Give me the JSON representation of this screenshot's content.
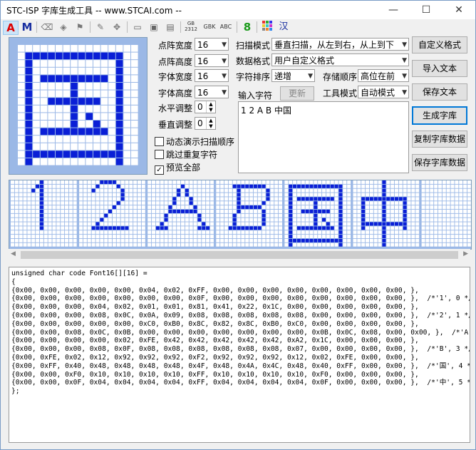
{
  "window": {
    "title": "STC-ISP 字库生成工具 -- www.STCAI.com --",
    "minimize": "—",
    "maximize": "☐",
    "close": "✕"
  },
  "toolbar": {
    "font_a": "A",
    "font_m": "M",
    "gb2312": "GB\n2312",
    "gbk": "GBK",
    "abc": "ABC",
    "eight": "8",
    "han": "汉"
  },
  "settings": {
    "dot_width_label": "点阵宽度",
    "dot_width_value": "16",
    "dot_height_label": "点阵高度",
    "dot_height_value": "16",
    "font_width_label": "字体宽度",
    "font_width_value": "16",
    "font_height_label": "字体高度",
    "font_height_value": "16",
    "h_adjust_label": "水平调整",
    "h_adjust_value": "0",
    "v_adjust_label": "垂直调整",
    "v_adjust_value": "0",
    "scan_mode_label": "扫描模式",
    "scan_mode_value": "垂直扫描，从左到右，从上到下",
    "data_format_label": "数据格式",
    "data_format_value": "用户自定义格式",
    "char_order_label": "字符排序",
    "char_order_value": "递增",
    "storage_order_label": "存储顺序",
    "storage_order_value": "高位在前",
    "input_chars_label": "输入字符",
    "update_button": "更新",
    "tool_mode_label": "工具模式",
    "tool_mode_value": "自动模式",
    "input_chars_value": "1 2 A B 中国"
  },
  "checkboxes": {
    "animate_scan": "动态演示扫描顺序",
    "skip_duplicates": "跳过重复字符",
    "preview_all": "预览全部",
    "preview_all_checked": true
  },
  "buttons": {
    "custom_format": "自定义格式",
    "import_text": "导入文本",
    "save_text": "保存文本",
    "generate_font": "生成字库",
    "copy_font_data": "复制字库数据",
    "save_font_data": "保存字库数据"
  },
  "preview": {
    "chars": [
      "1",
      "2",
      "A",
      "B",
      "中",
      "国"
    ]
  },
  "output": {
    "lines": [
      "unsigned char code Font16[][16] =",
      "{",
      "{0x00, 0x00, 0x00, 0x00, 0x00, 0x04, 0x02, 0xFF, 0x00, 0x00, 0x00, 0x00, 0x00, 0x00, 0x00, 0x00, },",
      "{0x00, 0x00, 0x00, 0x00, 0x00, 0x00, 0x00, 0x0F, 0x00, 0x00, 0x00, 0x00, 0x00, 0x00, 0x00, 0x00, },  /*'1', 0 */",
      "{0x00, 0x00, 0x00, 0x04, 0x02, 0x01, 0x01, 0x81, 0x41, 0x22, 0x1C, 0x00, 0x00, 0x00, 0x00, 0x00, },",
      "{0x00, 0x00, 0x00, 0x08, 0x0C, 0x0A, 0x09, 0x08, 0x08, 0x08, 0x08, 0x08, 0x00, 0x00, 0x00, 0x00, },  /*'2', 1 */",
      "{0x00, 0x00, 0x00, 0x00, 0x00, 0xC0, 0xB0, 0x8C, 0x82, 0x8C, 0xB0, 0xC0, 0x00, 0x00, 0x00, 0x00, },",
      "{0x00, 0x00, 0x08, 0x0C, 0x0B, 0x00, 0x00, 0x00, 0x00, 0x00, 0x00, 0x00, 0x0B, 0x0C, 0x08, 0x00, 0x00, },  /*'A', 2 */",
      "{0x00, 0x00, 0x00, 0x00, 0x02, 0xFE, 0x42, 0x42, 0x42, 0x42, 0x42, 0xA2, 0x1C, 0x00, 0x00, 0x00, },",
      "{0x00, 0x00, 0x00, 0x08, 0x0F, 0x08, 0x08, 0x08, 0x08, 0x08, 0x08, 0x07, 0x00, 0x00, 0x00, 0x00, },  /*'B', 3 */",
      "{0x00, 0xFE, 0x02, 0x12, 0x92, 0x92, 0x92, 0xF2, 0x92, 0x92, 0x92, 0x12, 0x02, 0xFE, 0x00, 0x00, },",
      "{0x00, 0xFF, 0x40, 0x48, 0x48, 0x48, 0x48, 0x4F, 0x48, 0x4A, 0x4C, 0x48, 0x40, 0xFF, 0x00, 0x00, },  /*'国', 4 */",
      "{0x00, 0x00, 0xF0, 0x10, 0x10, 0x10, 0x10, 0xFF, 0x10, 0x10, 0x10, 0x10, 0xF0, 0x00, 0x00, 0x00, },",
      "{0x00, 0x00, 0x0F, 0x04, 0x04, 0x04, 0x04, 0xFF, 0x04, 0x04, 0x04, 0x04, 0x0F, 0x00, 0x00, 0x00, },  /*'中', 5 */",
      "};"
    ]
  },
  "colors": {
    "grid_bg": "#e6f0ff",
    "grid_line": "#9bb8e6",
    "pixel_on": "#0a1fd6",
    "selection": "#0078d7"
  }
}
